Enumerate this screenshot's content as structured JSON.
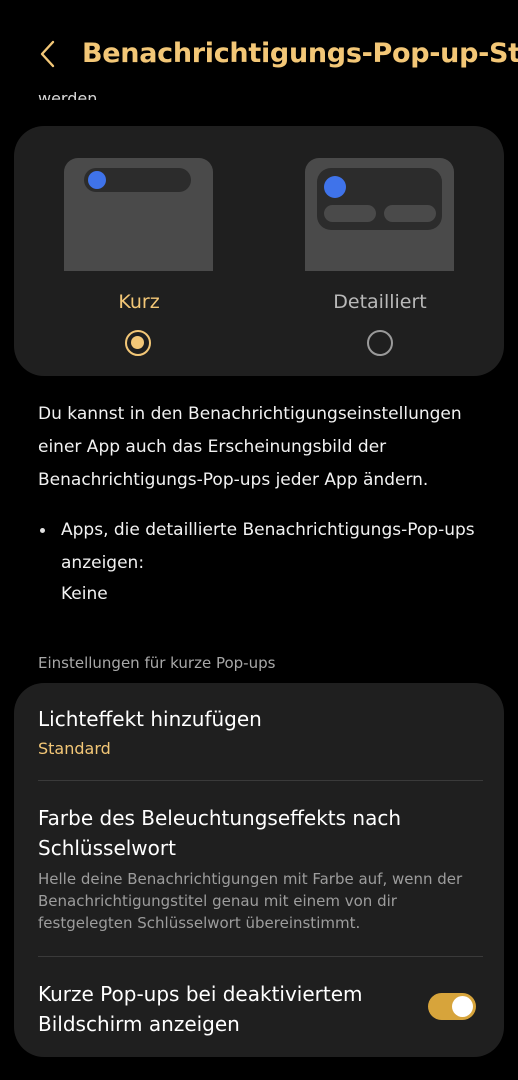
{
  "header": {
    "back_icon": "chevron-left-icon",
    "title": "Benachrichtigungs-Pop-up-Stil",
    "cut_text": "werden."
  },
  "style_options": [
    {
      "label": "Kurz",
      "selected": true
    },
    {
      "label": "Detailliert",
      "selected": false
    }
  ],
  "description": "Du kannst in den Benachrichtigungseinstellungen einer App auch das Erscheinungsbild der Benachrichtigungs-Pop-ups jeder App ändern.",
  "detailed_apps": {
    "label": "Apps, die detaillierte Benachrichtigungs-Pop-ups anzeigen:",
    "value": "Keine"
  },
  "section_header": "Einstellungen für kurze Pop-ups",
  "settings": {
    "light_effect": {
      "title": "Lichteffekt hinzufügen",
      "value": "Standard"
    },
    "keyword_color": {
      "title": "Farbe des Beleuchtungseffekts nach Schlüsselwort",
      "description": "Helle deine Benachrichtigungen mit Farbe auf, wenn der Benachrichtigungstitel genau mit einem von dir festgelegten Schlüsselwort übereinstimmt."
    },
    "screen_off": {
      "title": "Kurze Pop-ups bei deaktiviertem Bildschirm anzeigen",
      "enabled": true
    }
  },
  "colors": {
    "accent": "#f3c777",
    "toggle_on": "#d7a43b",
    "thumb_dot": "#3f73ea"
  }
}
